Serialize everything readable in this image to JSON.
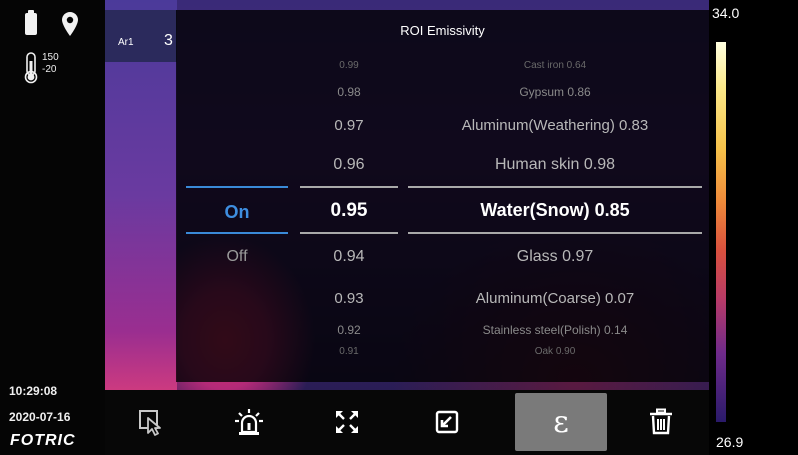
{
  "status": {
    "temp_range_high": "150",
    "temp_range_low": "-20",
    "time": "10:29:08",
    "date": "2020-07-16",
    "brand": "FOTRIC",
    "icons": [
      "battery-icon",
      "location-pin-icon",
      "thermometer-icon"
    ]
  },
  "measurement": {
    "area_label": "Ar1",
    "area_value": "3"
  },
  "dialog": {
    "title": "ROI Emissivity",
    "switch_options": [
      "On",
      "Off"
    ],
    "switch_selected": "On",
    "emissivity_values": [
      "0.99",
      "0.98",
      "0.97",
      "0.96",
      "0.95",
      "0.94",
      "0.93",
      "0.92",
      "0.91"
    ],
    "emissivity_selected": "0.95",
    "materials": [
      "Cast iron 0.64",
      "Gypsum 0.86",
      "Aluminum(Weathering) 0.83",
      "Human skin 0.98",
      "Water(Snow) 0.85",
      "Glass 0.97",
      "Aluminum(Coarse) 0.07",
      "Stainless steel(Polish) 0.14",
      "Oak 0.90"
    ],
    "material_selected": "Water(Snow) 0.85"
  },
  "color_scale": {
    "max": "34.0",
    "min": "26.9"
  },
  "toolbar": {
    "buttons": [
      "select-cursor-icon",
      "alarm-icon",
      "fullscreen-icon",
      "export-icon",
      "emissivity-icon",
      "trash-icon"
    ],
    "active": "emissivity-icon",
    "emissivity_symbol": "ε"
  },
  "colors": {
    "accent_blue": "#3a8ad8",
    "selected_button_bg": "#7a7a7a",
    "dialog_bg": "#000000"
  }
}
